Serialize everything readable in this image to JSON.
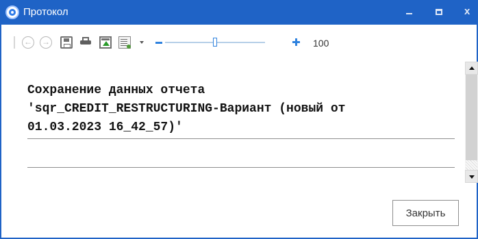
{
  "window": {
    "title": "Протокол",
    "title_bar_color": "#1f63c6",
    "title_icon": "app-icon",
    "controls": {
      "minimize_icon": "minimize-icon",
      "maximize_icon": "maximize-icon",
      "close_glyph": "x"
    }
  },
  "toolbar": {
    "items": [
      {
        "name": "back",
        "icon": "back-icon"
      },
      {
        "name": "forward",
        "icon": "forward-icon"
      },
      {
        "name": "save",
        "icon": "save-icon"
      },
      {
        "name": "print",
        "icon": "print-icon"
      },
      {
        "name": "export",
        "icon": "export-icon"
      },
      {
        "name": "settings",
        "icon": "settings-icon"
      }
    ],
    "zoom": {
      "value_text": "100",
      "slider_level": 0.5
    }
  },
  "report": {
    "text": "Сохранение данных отчета\n'sqr_CREDIT_RESTRUCTURING-Вариант (новый от\n01.03.2023 16_42_57)'"
  },
  "actions": {
    "close_button_label": "Закрыть"
  }
}
